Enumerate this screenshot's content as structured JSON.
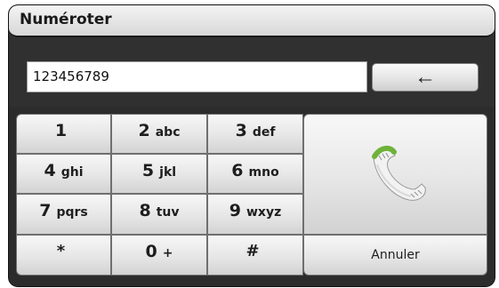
{
  "window": {
    "title": "Numéroter"
  },
  "display": {
    "value": "123456789"
  },
  "backspace": {
    "icon": "left-arrow-icon",
    "glyph": "←"
  },
  "keypad": {
    "keys": [
      {
        "num": "1",
        "letters": ""
      },
      {
        "num": "2",
        "letters": "abc"
      },
      {
        "num": "3",
        "letters": "def"
      },
      {
        "num": "4",
        "letters": "ghi"
      },
      {
        "num": "5",
        "letters": "jkl"
      },
      {
        "num": "6",
        "letters": "mno"
      },
      {
        "num": "7",
        "letters": "pqrs"
      },
      {
        "num": "8",
        "letters": "tuv"
      },
      {
        "num": "9",
        "letters": "wxyz"
      },
      {
        "num": "*",
        "letters": ""
      },
      {
        "num": "0",
        "letters": "+"
      },
      {
        "num": "#",
        "letters": ""
      }
    ],
    "call_icon": "phone-handset-icon",
    "cancel_label": "Annuler"
  },
  "colors": {
    "frame": "#303030",
    "handset_green": "#6fb23a",
    "handset_body": "#f2f2f2"
  }
}
